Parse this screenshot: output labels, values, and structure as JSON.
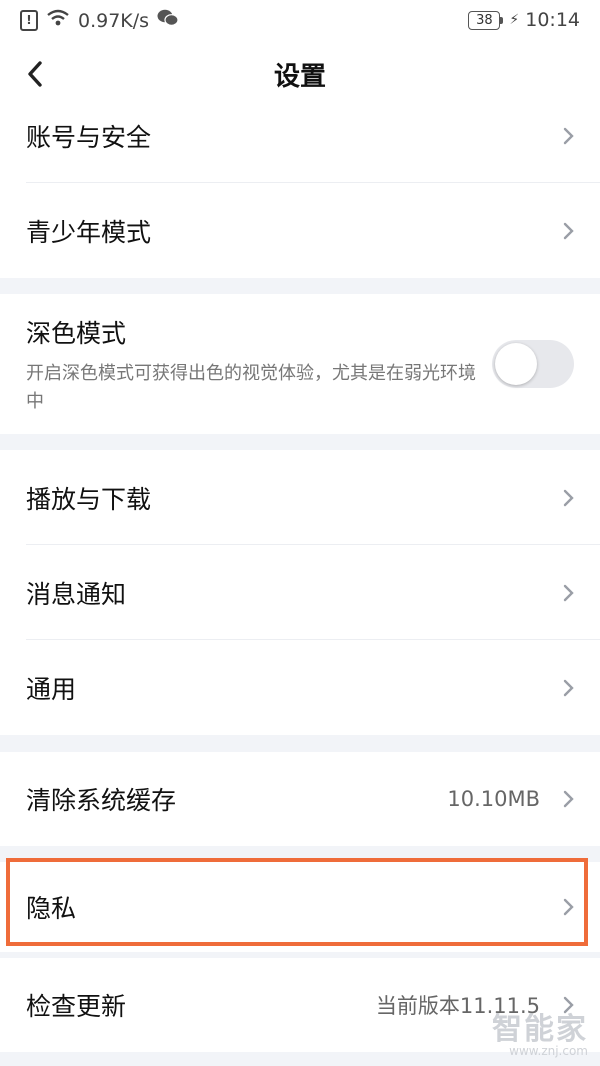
{
  "status_bar": {
    "alert": "!",
    "speed": "0.97K/s",
    "battery": "38",
    "time": "10:14"
  },
  "header": {
    "title": "设置"
  },
  "groups": [
    {
      "items": [
        {
          "label": "账号与安全"
        },
        {
          "label": "青少年模式"
        }
      ]
    },
    {
      "dark_mode": {
        "title": "深色模式",
        "desc": "开启深色模式可获得出色的视觉体验，尤其是在弱光环境中",
        "enabled": false
      }
    },
    {
      "items": [
        {
          "label": "播放与下载"
        },
        {
          "label": "消息通知"
        },
        {
          "label": "通用"
        }
      ]
    },
    {
      "items": [
        {
          "label": "清除系统缓存",
          "value": "10.10MB"
        }
      ]
    },
    {
      "items": [
        {
          "label": "隐私"
        }
      ]
    },
    {
      "items": [
        {
          "label": "检查更新",
          "value": "当前版本11.11.5"
        }
      ]
    }
  ],
  "highlight_color": "#ef6c3a",
  "watermark": {
    "main": "智能家",
    "sub": "www.znj.com"
  }
}
